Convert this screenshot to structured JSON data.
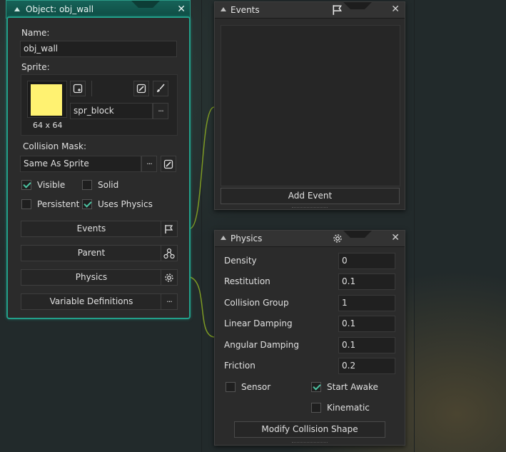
{
  "object_window": {
    "title": "Object: obj_wall",
    "name_label": "Name:",
    "name_value": "obj_wall",
    "sprite_label": "Sprite:",
    "sprite_size": "64 x 64",
    "sprite_name": "spr_block",
    "sprite_color": "#fff271",
    "collision_mask_label": "Collision Mask:",
    "collision_mask_value": "Same As Sprite",
    "checkboxes": {
      "visible": {
        "label": "Visible",
        "checked": true
      },
      "solid": {
        "label": "Solid",
        "checked": false
      },
      "persistent": {
        "label": "Persistent",
        "checked": false
      },
      "uses_physics": {
        "label": "Uses Physics",
        "checked": true
      }
    },
    "buttons": {
      "events": "Events",
      "parent": "Parent",
      "physics": "Physics",
      "variable_definitions": "Variable Definitions"
    },
    "accent_color": "#22a08a"
  },
  "events_window": {
    "title": "Events",
    "add_event_label": "Add Event"
  },
  "physics_window": {
    "title": "Physics",
    "fields": [
      {
        "label": "Density",
        "value": "0"
      },
      {
        "label": "Restitution",
        "value": "0.1"
      },
      {
        "label": "Collision Group",
        "value": "1"
      },
      {
        "label": "Linear Damping",
        "value": "0.1"
      },
      {
        "label": "Angular Damping",
        "value": "0.1"
      },
      {
        "label": "Friction",
        "value": "0.2"
      }
    ],
    "sensor": {
      "label": "Sensor",
      "checked": false
    },
    "start_awake": {
      "label": "Start Awake",
      "checked": true
    },
    "kinematic": {
      "label": "Kinematic",
      "checked": false
    },
    "modify_label": "Modify Collision Shape"
  },
  "icons": [
    "close-icon",
    "collapse-triangle-icon",
    "flag-icon",
    "gear-icon",
    "parent-tree-icon",
    "new-sprite-icon",
    "edit-sprite-icon",
    "paint-brush-icon",
    "ellipsis-icon"
  ]
}
